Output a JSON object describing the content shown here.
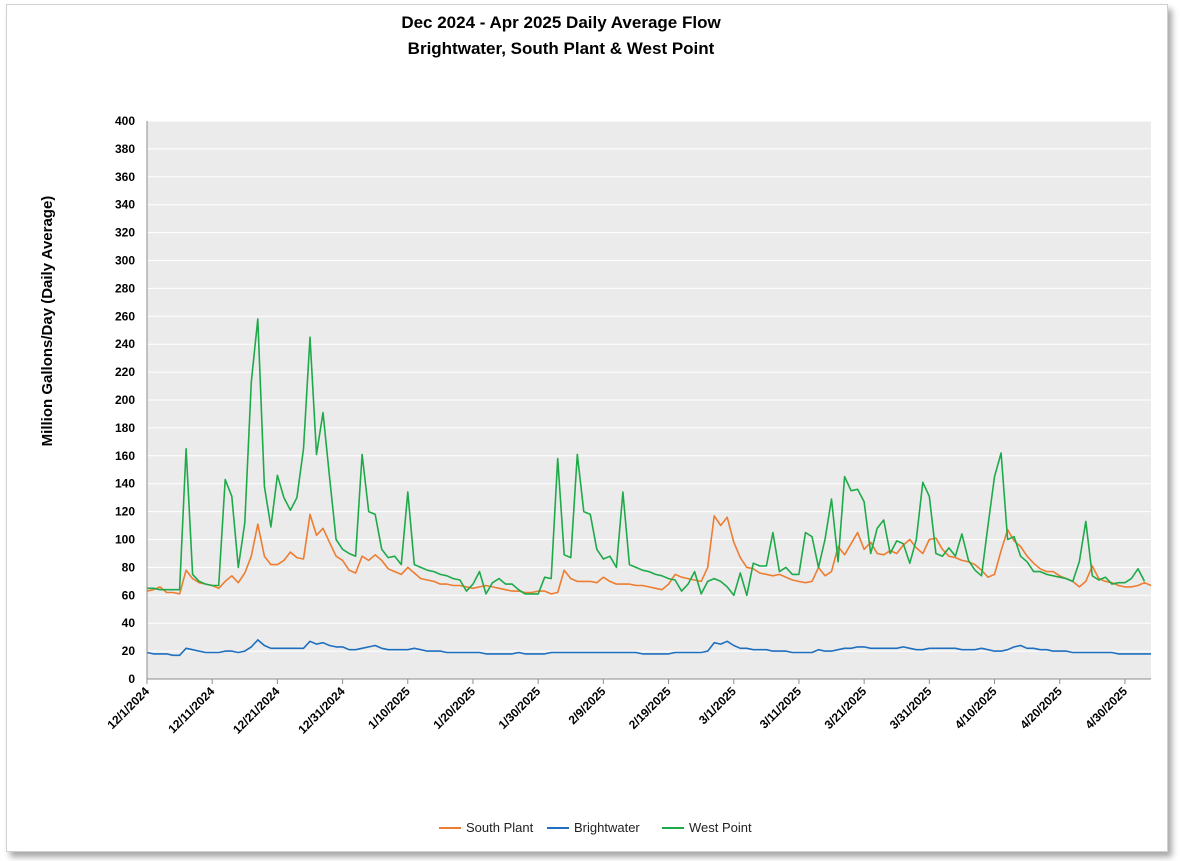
{
  "chart_data": {
    "type": "line",
    "title": "Dec 2024 - Apr 2025 Daily Average Flow",
    "subtitle": "Brightwater, South Plant & West Point",
    "ylabel": "Million Gallons/Day (Daily Average)",
    "xlabel": "",
    "x_start": "12/1/2024",
    "x_end": "4/30/2025",
    "xticks": [
      "12/1/2024",
      "12/11/2024",
      "12/21/2024",
      "12/31/2024",
      "1/10/2025",
      "1/20/2025",
      "1/30/2025",
      "2/9/2025",
      "2/19/2025",
      "3/1/2025",
      "3/11/2025",
      "3/21/2025",
      "3/31/2025",
      "4/10/2025",
      "4/20/2025",
      "4/30/2025"
    ],
    "ylim": [
      0,
      400
    ],
    "yticks": [
      0,
      20,
      40,
      60,
      80,
      100,
      120,
      140,
      160,
      180,
      200,
      220,
      240,
      260,
      280,
      300,
      320,
      340,
      360,
      380,
      400
    ],
    "grid": true,
    "background": "#ebebeb",
    "legend_position": "bottom",
    "series": [
      {
        "name": "South Plant",
        "color": "#ed7d31",
        "values": [
          63,
          64,
          66,
          62,
          62,
          61,
          78,
          72,
          69,
          68,
          67,
          65,
          70,
          74,
          69,
          76,
          88,
          111,
          88,
          82,
          82,
          85,
          91,
          87,
          86,
          118,
          103,
          108,
          98,
          88,
          85,
          78,
          76,
          88,
          85,
          89,
          85,
          79,
          77,
          75,
          80,
          76,
          72,
          71,
          70,
          68,
          68,
          67,
          67,
          66,
          65,
          66,
          67,
          66,
          65,
          64,
          63,
          63,
          62,
          62,
          63,
          63,
          61,
          62,
          78,
          72,
          70,
          70,
          70,
          69,
          73,
          70,
          68,
          68,
          68,
          67,
          67,
          66,
          65,
          64,
          68,
          75,
          73,
          72,
          71,
          70,
          80,
          117,
          110,
          116,
          98,
          87,
          80,
          79,
          76,
          75,
          74,
          75,
          73,
          71,
          70,
          69,
          70,
          80,
          74,
          77,
          95,
          89,
          97,
          105,
          93,
          98,
          90,
          89,
          92,
          90,
          96,
          100,
          94,
          90,
          100,
          101,
          93,
          88,
          87,
          85,
          84,
          82,
          78,
          73,
          75,
          92,
          107,
          99,
          95,
          88,
          83,
          79,
          77,
          77,
          74,
          72,
          70,
          66,
          70,
          81,
          72,
          70,
          69,
          67,
          66,
          66,
          67,
          69,
          67
        ]
      },
      {
        "name": "Brightwater",
        "color": "#1f6fbf",
        "values": [
          19,
          18,
          18,
          18,
          17,
          17,
          22,
          21,
          20,
          19,
          19,
          19,
          20,
          20,
          19,
          20,
          23,
          28,
          24,
          22,
          22,
          22,
          22,
          22,
          22,
          27,
          25,
          26,
          24,
          23,
          23,
          21,
          21,
          22,
          23,
          24,
          22,
          21,
          21,
          21,
          21,
          22,
          21,
          20,
          20,
          20,
          19,
          19,
          19,
          19,
          19,
          19,
          18,
          18,
          18,
          18,
          18,
          19,
          18,
          18,
          18,
          18,
          19,
          19,
          19,
          19,
          19,
          19,
          19,
          19,
          19,
          19,
          19,
          19,
          19,
          19,
          18,
          18,
          18,
          18,
          18,
          19,
          19,
          19,
          19,
          19,
          20,
          26,
          25,
          27,
          24,
          22,
          22,
          21,
          21,
          21,
          20,
          20,
          20,
          19,
          19,
          19,
          19,
          21,
          20,
          20,
          21,
          22,
          22,
          23,
          23,
          22,
          22,
          22,
          22,
          22,
          23,
          22,
          21,
          21,
          22,
          22,
          22,
          22,
          22,
          21,
          21,
          21,
          22,
          21,
          20,
          20,
          21,
          23,
          24,
          22,
          22,
          21,
          21,
          20,
          20,
          20,
          19,
          19,
          19,
          19,
          19,
          19,
          19,
          18,
          18,
          18,
          18,
          18,
          18
        ]
      },
      {
        "name": "West Point",
        "color": "#1faa4a",
        "values": [
          65,
          65,
          64,
          64,
          64,
          64,
          165,
          75,
          70,
          68,
          67,
          67,
          143,
          131,
          80,
          112,
          213,
          258,
          138,
          109,
          146,
          130,
          121,
          130,
          165,
          245,
          161,
          191,
          145,
          100,
          93,
          90,
          88,
          161,
          120,
          118,
          93,
          87,
          88,
          82,
          134,
          82,
          80,
          78,
          77,
          75,
          74,
          72,
          71,
          63,
          68,
          77,
          61,
          69,
          72,
          68,
          68,
          64,
          61,
          61,
          61,
          73,
          72,
          158,
          89,
          87,
          161,
          120,
          118,
          93,
          86,
          88,
          80,
          134,
          82,
          80,
          78,
          77,
          75,
          74,
          72,
          71,
          63,
          68,
          77,
          61,
          70,
          72,
          70,
          66,
          60,
          76,
          60,
          83,
          81,
          81,
          105,
          77,
          80,
          75,
          75,
          105,
          102,
          80,
          100,
          129,
          84,
          145,
          135,
          136,
          127,
          90,
          108,
          114,
          90,
          99,
          97,
          83,
          100,
          141,
          131,
          90,
          88,
          94,
          88,
          104,
          85,
          78,
          74,
          110,
          145,
          162,
          100,
          102,
          88,
          84,
          77,
          77,
          75,
          74,
          73,
          72,
          70,
          84,
          113,
          74,
          71,
          73,
          68,
          69,
          69,
          72,
          79,
          70
        ]
      }
    ]
  }
}
